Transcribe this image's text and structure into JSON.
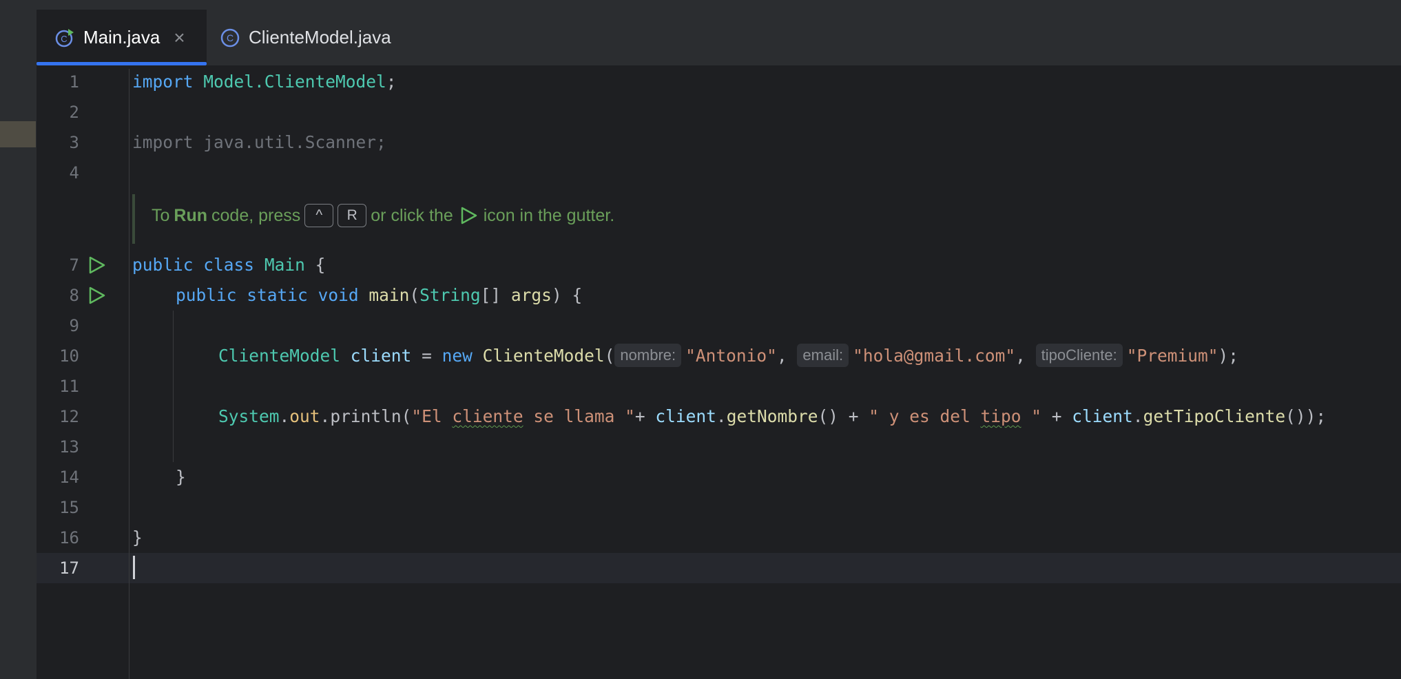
{
  "tabs": [
    {
      "label": "Main.java",
      "active": true,
      "icon": "java-class-run-icon"
    },
    {
      "label": "ClienteModel.java",
      "active": false,
      "icon": "java-class-icon"
    }
  ],
  "close_glyph": "×",
  "colors": {
    "background": "#1e1f22",
    "keyword": "#56a8f5",
    "class_name": "#4ec9b0",
    "string": "#ce9178",
    "tab_underline": "#3574f0",
    "tip_text": "#6a9f5a"
  },
  "tip": {
    "prefix": "To",
    "run_word": "Run",
    "middle": "code, press",
    "key1": "^",
    "key2": "R",
    "after_keys": "or click the",
    "suffix": "icon in the gutter."
  },
  "line_numbers": [
    "1",
    "2",
    "3",
    "4",
    "7",
    "8",
    "9",
    "10",
    "11",
    "12",
    "13",
    "14",
    "15",
    "16",
    "17"
  ],
  "code": {
    "l1": {
      "kw": "import",
      "pkg": "Model.ClienteModel",
      "end": ";"
    },
    "l3": {
      "text": "import java.util.Scanner;"
    },
    "l7": {
      "kw1": "public",
      "kw2": "class",
      "cls": "Main",
      "brace": "{"
    },
    "l8": {
      "kw1": "public",
      "kw2": "static",
      "kw3": "void",
      "fn": "main",
      "open": "(",
      "type": "String",
      "arr": "[]",
      "param": "args",
      "close": ") {"
    },
    "l10": {
      "type": "ClienteModel",
      "var": "client",
      "eq": "=",
      "kw": "new",
      "ctor": "ClienteModel",
      "open": "(",
      "hint1": "nombre:",
      "arg1": "\"Antonio\"",
      "comma1": ",",
      "hint2": "email:",
      "arg2": "\"hola@gmail.com\"",
      "comma2": ",",
      "hint3": "tipoCliente:",
      "arg3": "\"Premium\"",
      "close": ");"
    },
    "l12": {
      "sys": "System",
      "dot1": ".",
      "out": "out",
      "dot2": ".",
      "println": "println",
      "open": "(",
      "s1a": "\"El ",
      "s1b": "cliente",
      "s1c": " se llama \"",
      "plus1": "+ ",
      "v1": "client",
      "dot3": ".",
      "m1": "getNombre",
      "paren1": "() + ",
      "s2a": "\" y es del ",
      "s2b": "tipo",
      "s2c": " \"",
      "plus2": " + ",
      "v2": "client",
      "dot4": ".",
      "m2": "getTipoCliente",
      "close": "());"
    },
    "l14": {
      "brace": "}"
    },
    "l16": {
      "brace": "}"
    }
  }
}
